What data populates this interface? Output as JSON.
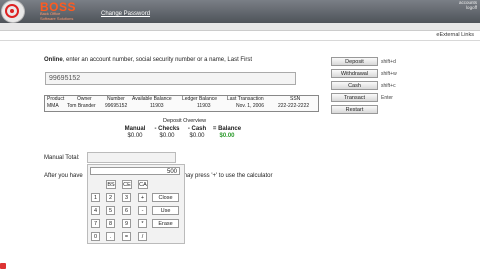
{
  "header": {
    "brand": "BOSS",
    "brand_sub_1": "Back Office",
    "brand_sub_2": "Software Solutions",
    "change_password": "Change Password",
    "user_line_1": "accounts",
    "user_line_2": "logoff"
  },
  "external_links": "eExternal Links",
  "search": {
    "instruction_bold": "Online",
    "instruction_rest": ", enter an account number, social security number or a name, Last First",
    "value": "99695152"
  },
  "actions": [
    {
      "label": "Deposit",
      "hint": "shift+d"
    },
    {
      "label": "Withdrawal",
      "hint": "shift+w"
    },
    {
      "label": "Cash",
      "hint": "shift+c"
    },
    {
      "label": "Transact",
      "hint": "Enter"
    },
    {
      "label": "Restart",
      "hint": ""
    }
  ],
  "account_table": {
    "headers": [
      "Product",
      "Owner",
      "Number",
      "Available Balance",
      "Ledger Balance",
      "Last Transaction",
      "SSN"
    ],
    "row": [
      "MMA",
      "Tom Brander",
      "99695152",
      "11903",
      "11903",
      "Nov. 1, 2006",
      "222-222-2222"
    ]
  },
  "deposit_overview": {
    "title": "Deposit Overview",
    "labels": [
      "Manual",
      "- Checks",
      "- Cash",
      "= Balance"
    ],
    "values": [
      "$0.00",
      "$0.00",
      "$0.00",
      "$0.00"
    ]
  },
  "manual_total_label": "Manual Total:",
  "calculator_hint_left": "After you have",
  "calculator_hint_right": "may press '+' to use the calculator",
  "calculator": {
    "display": "500",
    "row1": [
      "BS",
      "CE",
      "CA"
    ],
    "row2": [
      "1",
      "2",
      "3",
      "+"
    ],
    "row3": [
      "4",
      "5",
      "6",
      "-"
    ],
    "row4": [
      "7",
      "8",
      "9",
      "*"
    ],
    "row5": [
      "0",
      ".",
      "=",
      "/"
    ],
    "close": "Close",
    "use": "Use",
    "erase": "Erase"
  },
  "colors": {
    "brand": "#ff5a1f",
    "balance_green": "#2a9a2a"
  }
}
